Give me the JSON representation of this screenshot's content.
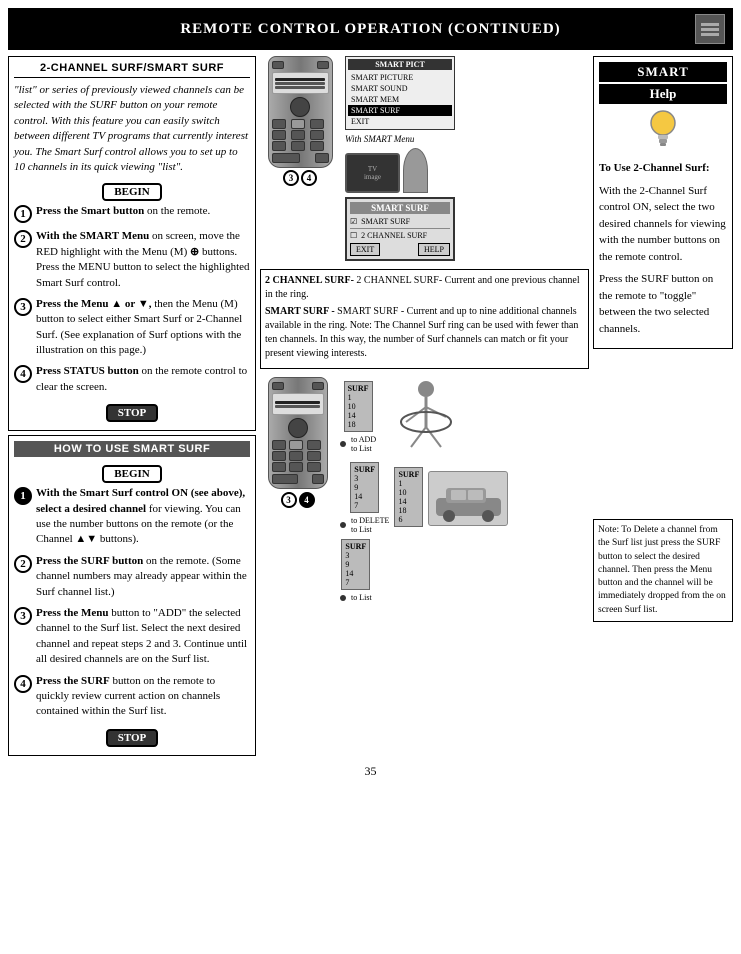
{
  "header": {
    "title": "Remote Control Operation (Continued)"
  },
  "top_left": {
    "section_title": "2-Channel Surf/Smart Surf",
    "intro": "\"list\" or series of previously viewed channels can be selected with the SURF button on your remote control. With this feature you can easily switch between different TV programs that currently interest you. The Smart Surf control allows you to set up to 10 channels in its quick viewing \"list\".",
    "badge_begin": "BEGIN",
    "steps": [
      {
        "num": "1",
        "text": "Press the Smart button on the remote."
      },
      {
        "num": "2",
        "text": "With the SMART Menu on screen, move the RED highlight with the Menu (M) buttons. Press the MENU button to select the highlighted Smart Surf control."
      },
      {
        "num": "3",
        "text": "Press the Menu ▲ or ▼, then the Menu (M) button to select either Smart Surf or 2-Channel Surf. (See explanation of Surf options with the illustration on this page.)"
      },
      {
        "num": "4",
        "text": "Press STATUS button on the remote control to clear the screen."
      }
    ],
    "badge_stop": "STOP"
  },
  "smart_menu_screen": {
    "title": "SMART PICT",
    "items": [
      {
        "label": "SMART PICTURE",
        "selected": false
      },
      {
        "label": "SMART SOUND",
        "selected": false
      },
      {
        "label": "SMART MEM",
        "selected": false
      },
      {
        "label": "SMART SURF",
        "selected": true
      },
      {
        "label": "EXIT",
        "selected": false
      }
    ]
  },
  "with_smart_menu_label": "With SMART Menu",
  "surf_screen": {
    "items": [
      {
        "label": "SMART SURF",
        "checked": true
      },
      {
        "label": "2 CHANNEL SURF",
        "checked": false
      }
    ],
    "buttons": [
      "EXIT",
      "HELP"
    ]
  },
  "info_box": {
    "channel_surf_text": "2 CHANNEL SURF- Current and one previous channel in the ring.",
    "smart_surf_text": "SMART SURF - Current and up to nine additional channels available in the ring. Note: The Channel Surf ring can be used with fewer than ten channels. In this way, the number of Surf channels can match or fit your present viewing interests."
  },
  "smart_help": {
    "title": "Smart",
    "subtitle": "Help",
    "bulb": "💡",
    "heading1": "To Use 2-Channel Surf:",
    "para1": "With the 2-Channel Surf control ON, select the two desired channels for viewing with the number buttons on the remote control.",
    "para2": "Press the SURF button on the remote to \"toggle\" between the two selected channels."
  },
  "bottom_left": {
    "section_title": "How To Use Smart Surf",
    "badge_begin": "BEGIN",
    "steps": [
      {
        "num": "1",
        "text_bold": "With the Smart Surf control ON (see above), select a desired channel",
        "text_rest": " for viewing. You can use the number buttons on the remote (or the Channel ▲▼ buttons)."
      },
      {
        "num": "2",
        "text": "Press the SURF button on the remote. (Some channel numbers may already appear within the Surf channel list.)"
      },
      {
        "num": "3",
        "text_bold": "Press the Menu",
        "text_rest": " button to \"ADD\" the selected channel to the Surf list. Select the next desired channel and repeat steps 2 and 3. Continue until all desired channels are on the Surf list."
      },
      {
        "num": "4",
        "text_bold": "Press the SURF",
        "text_rest": " button on the remote to quickly review current action on channels contained within the Surf list."
      }
    ],
    "badge_stop": "STOP"
  },
  "note_box": {
    "text": "Note: To Delete a channel from the Surf list just press the SURF button to select the desired channel. Then press the Menu button and the channel will be immediately dropped from the on screen Surf list."
  },
  "surf_lists": {
    "list1": {
      "header": "SURF",
      "items": [
        "1",
        "10",
        "14",
        "18"
      ],
      "label": "to ADD to List"
    },
    "list2": {
      "header": "SURF",
      "items": [
        "3",
        "9",
        "14",
        "7"
      ],
      "label": "to DELETE to List"
    },
    "list3": {
      "header": "SURF",
      "items": [
        "1",
        "10",
        "14",
        "18",
        "6"
      ],
      "label": ""
    },
    "list4": {
      "header": "SURF",
      "items": [
        "3",
        "9",
        "14",
        "7"
      ],
      "label": "to List"
    }
  },
  "page_number": "35"
}
